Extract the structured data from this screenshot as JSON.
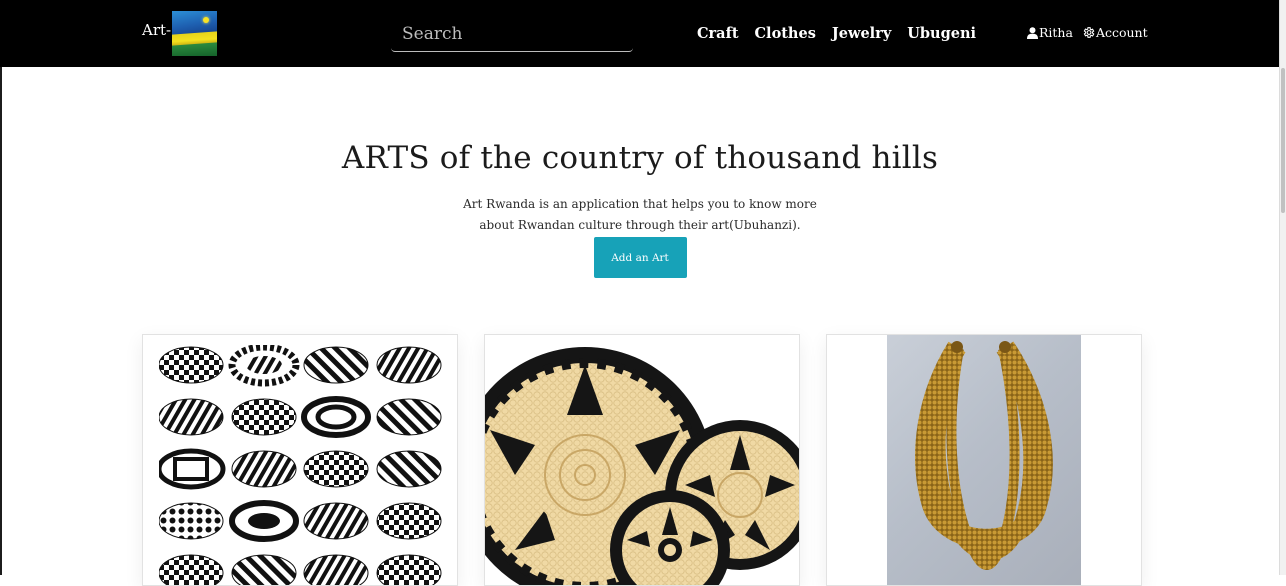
{
  "nav": {
    "brand_text": "Art-",
    "flag_name": "rwanda-flag",
    "search_placeholder": "Search",
    "links": [
      "Craft",
      "Clothes",
      "Jewelry",
      "Ubugeni"
    ],
    "user_label": "Ritha",
    "account_label": "Account"
  },
  "hero": {
    "title": "ARTS of the country of thousand hills",
    "description": "Art Rwanda is an application that helps you to know more about Rwandan culture through their art(Ubuhanzi).",
    "button_label": "Add an Art"
  },
  "cards": [
    {
      "image_name": "optical-illusion-patterns"
    },
    {
      "image_name": "rwandan-baskets"
    },
    {
      "image_name": "gold-beaded-necklace"
    }
  ],
  "colors": {
    "navbar": "#000000",
    "accent": "#17a2b8",
    "text": "#1b1b1b"
  }
}
